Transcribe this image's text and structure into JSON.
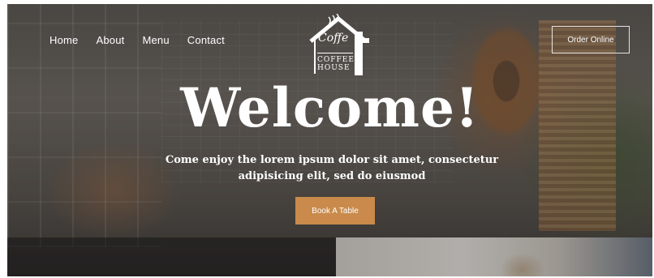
{
  "nav": {
    "items": [
      {
        "label": "Home"
      },
      {
        "label": "About"
      },
      {
        "label": "Menu"
      },
      {
        "label": "Contact"
      }
    ]
  },
  "logo": {
    "script": "Coffe",
    "line1": "COFFEE",
    "line2": "HOUSE"
  },
  "header": {
    "cta_label": "Order Online"
  },
  "hero": {
    "title": "Welcome!",
    "subtitle_line1": "Come enjoy the lorem ipsum dolor sit amet, consectetur",
    "subtitle_line2": "adipisicing elit, sed do eiusmod",
    "button_label": "Book A Table"
  },
  "colors": {
    "accent": "#c98a4b",
    "text": "#ffffff"
  },
  "icons": {
    "logo": "house-logo-icon"
  }
}
